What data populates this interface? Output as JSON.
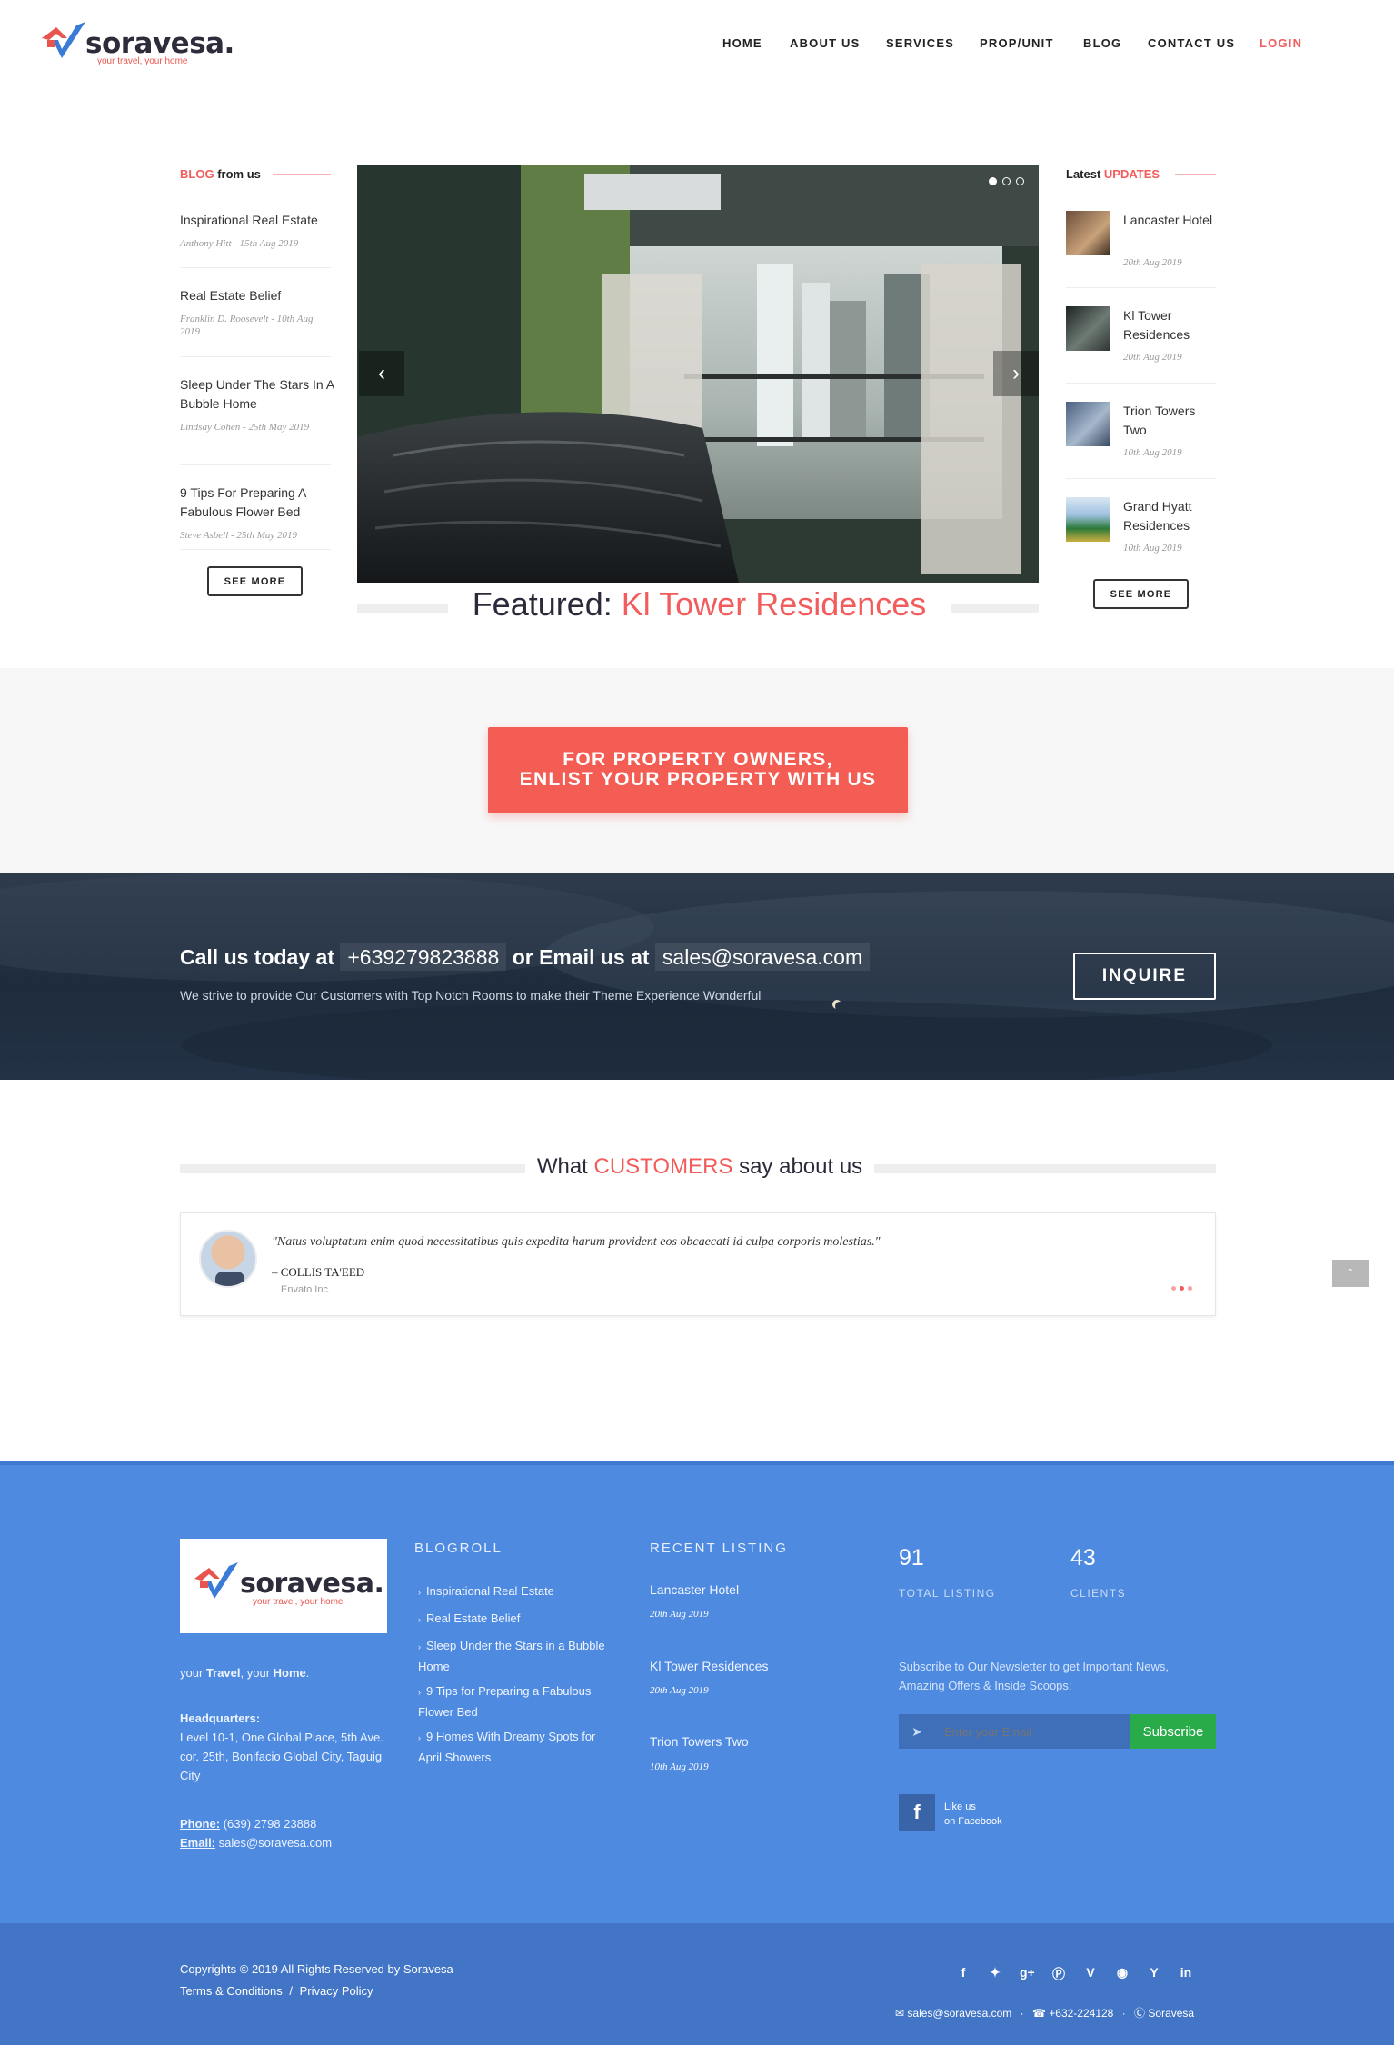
{
  "header": {
    "logo_name": "soravesa.",
    "logo_tagline": "your travel, your home",
    "nav": [
      {
        "label": "HOME"
      },
      {
        "label": "ABOUT US"
      },
      {
        "label": "SERVICES"
      },
      {
        "label": "PROP/UNIT"
      },
      {
        "label": "BLOG"
      },
      {
        "label": "CONTACT US"
      },
      {
        "label": "LOGIN"
      }
    ]
  },
  "blog_sidebar": {
    "title_accent": "BLOG",
    "title_rest": "from us",
    "posts": [
      {
        "title": "Inspirational Real Estate",
        "meta": "Anthony Hitt - 15th Aug 2019"
      },
      {
        "title": "Real Estate Belief",
        "meta": "Franklin D. Roosevelt - 10th Aug 2019"
      },
      {
        "title": "Sleep Under The Stars In A Bubble Home",
        "meta": "Lindsay Cohen - 25th May 2019"
      },
      {
        "title": "9 Tips For Preparing A Fabulous Flower Bed",
        "meta": "Steve Asbell - 25th May 2019"
      }
    ],
    "see_more": "SEE MORE"
  },
  "featured": {
    "prefix": "Featured:",
    "name": "Kl Tower Residences",
    "prev_icon": "chevron-left-icon",
    "next_icon": "chevron-right-icon",
    "dots": 3,
    "active_dot": 0
  },
  "updates_sidebar": {
    "title_prefix": "Latest",
    "title_accent": "UPDATES",
    "items": [
      {
        "title": "Lancaster Hotel",
        "date": "20th Aug 2019"
      },
      {
        "title": "Kl Tower Residences",
        "date": "20th Aug 2019"
      },
      {
        "title": "Trion Towers Two",
        "date": "10th Aug 2019"
      },
      {
        "title": "Grand Hyatt Residences",
        "date": "10th Aug 2019"
      }
    ],
    "see_more": "SEE MORE"
  },
  "cta": {
    "line1": "FOR PROPERTY OWNERS,",
    "line2": "ENLIST YOUR PROPERTY WITH US"
  },
  "callus": {
    "call_label": "Call us today at",
    "phone": "+639279823888",
    "email_label": "or Email us at",
    "email": "sales@soravesa.com",
    "subtitle": "We strive to provide Our Customers with Top Notch Rooms to make their Theme Experience Wonderful",
    "inquire": "INQUIRE"
  },
  "testimonials": {
    "title_prefix": "What",
    "title_accent": "CUSTOMERS",
    "title_suffix": "say about us",
    "quote": "\"Natus voluptatum enim quod necessitatibus quis expedita harum provident eos obcaecati id culpa corporis molestias.\"",
    "author": "– COLLIS TA'EED",
    "company": "Envato Inc.",
    "dots": 3
  },
  "footer": {
    "logo_name": "soravesa.",
    "logo_tagline": "your travel, your home",
    "tagline_a": "your",
    "tagline_b": "Travel",
    "tagline_c": ", your",
    "tagline_d": "Home",
    "tagline_e": ".",
    "hq_label": "Headquarters:",
    "hq_address": "Level 10-1, One Global Place, 5th Ave. cor. 25th, Bonifacio Global City, Taguig City",
    "phone_label": "Phone:",
    "phone": "(639) 2798 23888",
    "email_label": "Email:",
    "email": "sales@soravesa.com",
    "blogroll_title": "BLOGROLL",
    "blogroll": [
      "Inspirational Real Estate",
      "Real Estate Belief",
      "Sleep Under the Stars in a Bubble Home",
      "9 Tips for Preparing a Fabulous Flower Bed",
      "9 Homes With Dreamy Spots for April Showers"
    ],
    "recent_title": "RECENT LISTING",
    "recent": [
      {
        "title": "Lancaster Hotel",
        "date": "20th Aug 2019"
      },
      {
        "title": "Kl Tower Residences",
        "date": "20th Aug 2019"
      },
      {
        "title": "Trion Towers Two",
        "date": "10th Aug 2019"
      }
    ],
    "stats": [
      {
        "value": "91",
        "label": "TOTAL LISTING"
      },
      {
        "value": "43",
        "label": "CLIENTS"
      }
    ],
    "newsletter_text": "Subscribe to Our Newsletter to get Important News, Amazing Offers & Inside Scoops:",
    "newsletter_placeholder": "Enter your Email",
    "subscribe": "Subscribe",
    "like_us": "Like us",
    "on_facebook": "on Facebook"
  },
  "bottom": {
    "copyright": "Copyrights © 2019 All Rights Reserved by Soravesa",
    "terms": "Terms & Conditions",
    "sep": "/",
    "privacy": "Privacy Policy",
    "social_icons": [
      "facebook-icon",
      "twitter-icon",
      "google-plus-icon",
      "pinterest-icon",
      "vimeo-icon",
      "github-icon",
      "yahoo-icon",
      "linkedin-icon"
    ],
    "contact_email": "sales@soravesa.com",
    "contact_phone": "+632-224128",
    "contact_skype": "Soravesa"
  },
  "colors": {
    "accent": "#f25c5c",
    "cta_button": "#f45d54",
    "footer": "#4e8ae0",
    "footer_bottom": "#4275c6",
    "subscribe": "#2aab4a"
  }
}
